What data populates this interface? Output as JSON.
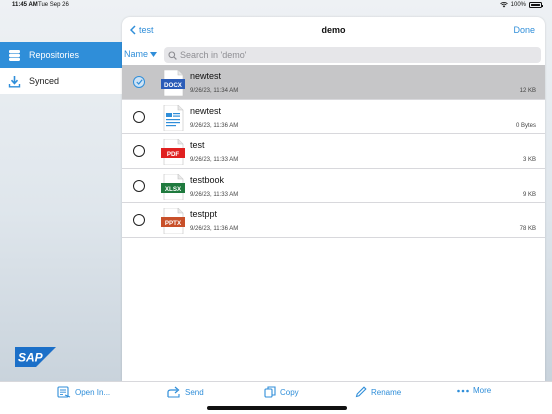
{
  "status_bar": {
    "time": "11:45 AM",
    "date": "Tue Sep 26",
    "battery": "100%"
  },
  "sidebar": {
    "items": [
      {
        "label": "Repositories",
        "icon": "database-icon",
        "active": true
      },
      {
        "label": "Synced",
        "icon": "download-icon",
        "active": false
      }
    ],
    "logo_text": "SAP"
  },
  "nav": {
    "back_label": "test",
    "title": "demo",
    "done_label": "Done"
  },
  "filter": {
    "sort_label": "Name",
    "search_placeholder": "Search in 'demo'"
  },
  "files": [
    {
      "name": "newtest",
      "type": "DOCX",
      "date": "9/26/23, 11:34 AM",
      "size": "12 KB",
      "selected": true
    },
    {
      "name": "newtest",
      "type": "TXT",
      "date": "9/26/23, 11:36 AM",
      "size": "0 Bytes",
      "selected": false
    },
    {
      "name": "test",
      "type": "PDF",
      "date": "9/26/23, 11:33 AM",
      "size": "3 KB",
      "selected": false
    },
    {
      "name": "testbook",
      "type": "XLSX",
      "date": "9/26/23, 11:33 AM",
      "size": "9 KB",
      "selected": false
    },
    {
      "name": "testppt",
      "type": "PPTX",
      "date": "9/26/23, 11:36 AM",
      "size": "78 KB",
      "selected": false
    }
  ],
  "toolbar": {
    "open_in": "Open In...",
    "send": "Send",
    "copy": "Copy",
    "rename": "Rename",
    "more": "More"
  },
  "colors": {
    "accent": "#2f8ed9",
    "docx": "#2b5cb8",
    "pdf": "#e02020",
    "xlsx": "#1f7a3e",
    "pptx": "#c8502a"
  }
}
